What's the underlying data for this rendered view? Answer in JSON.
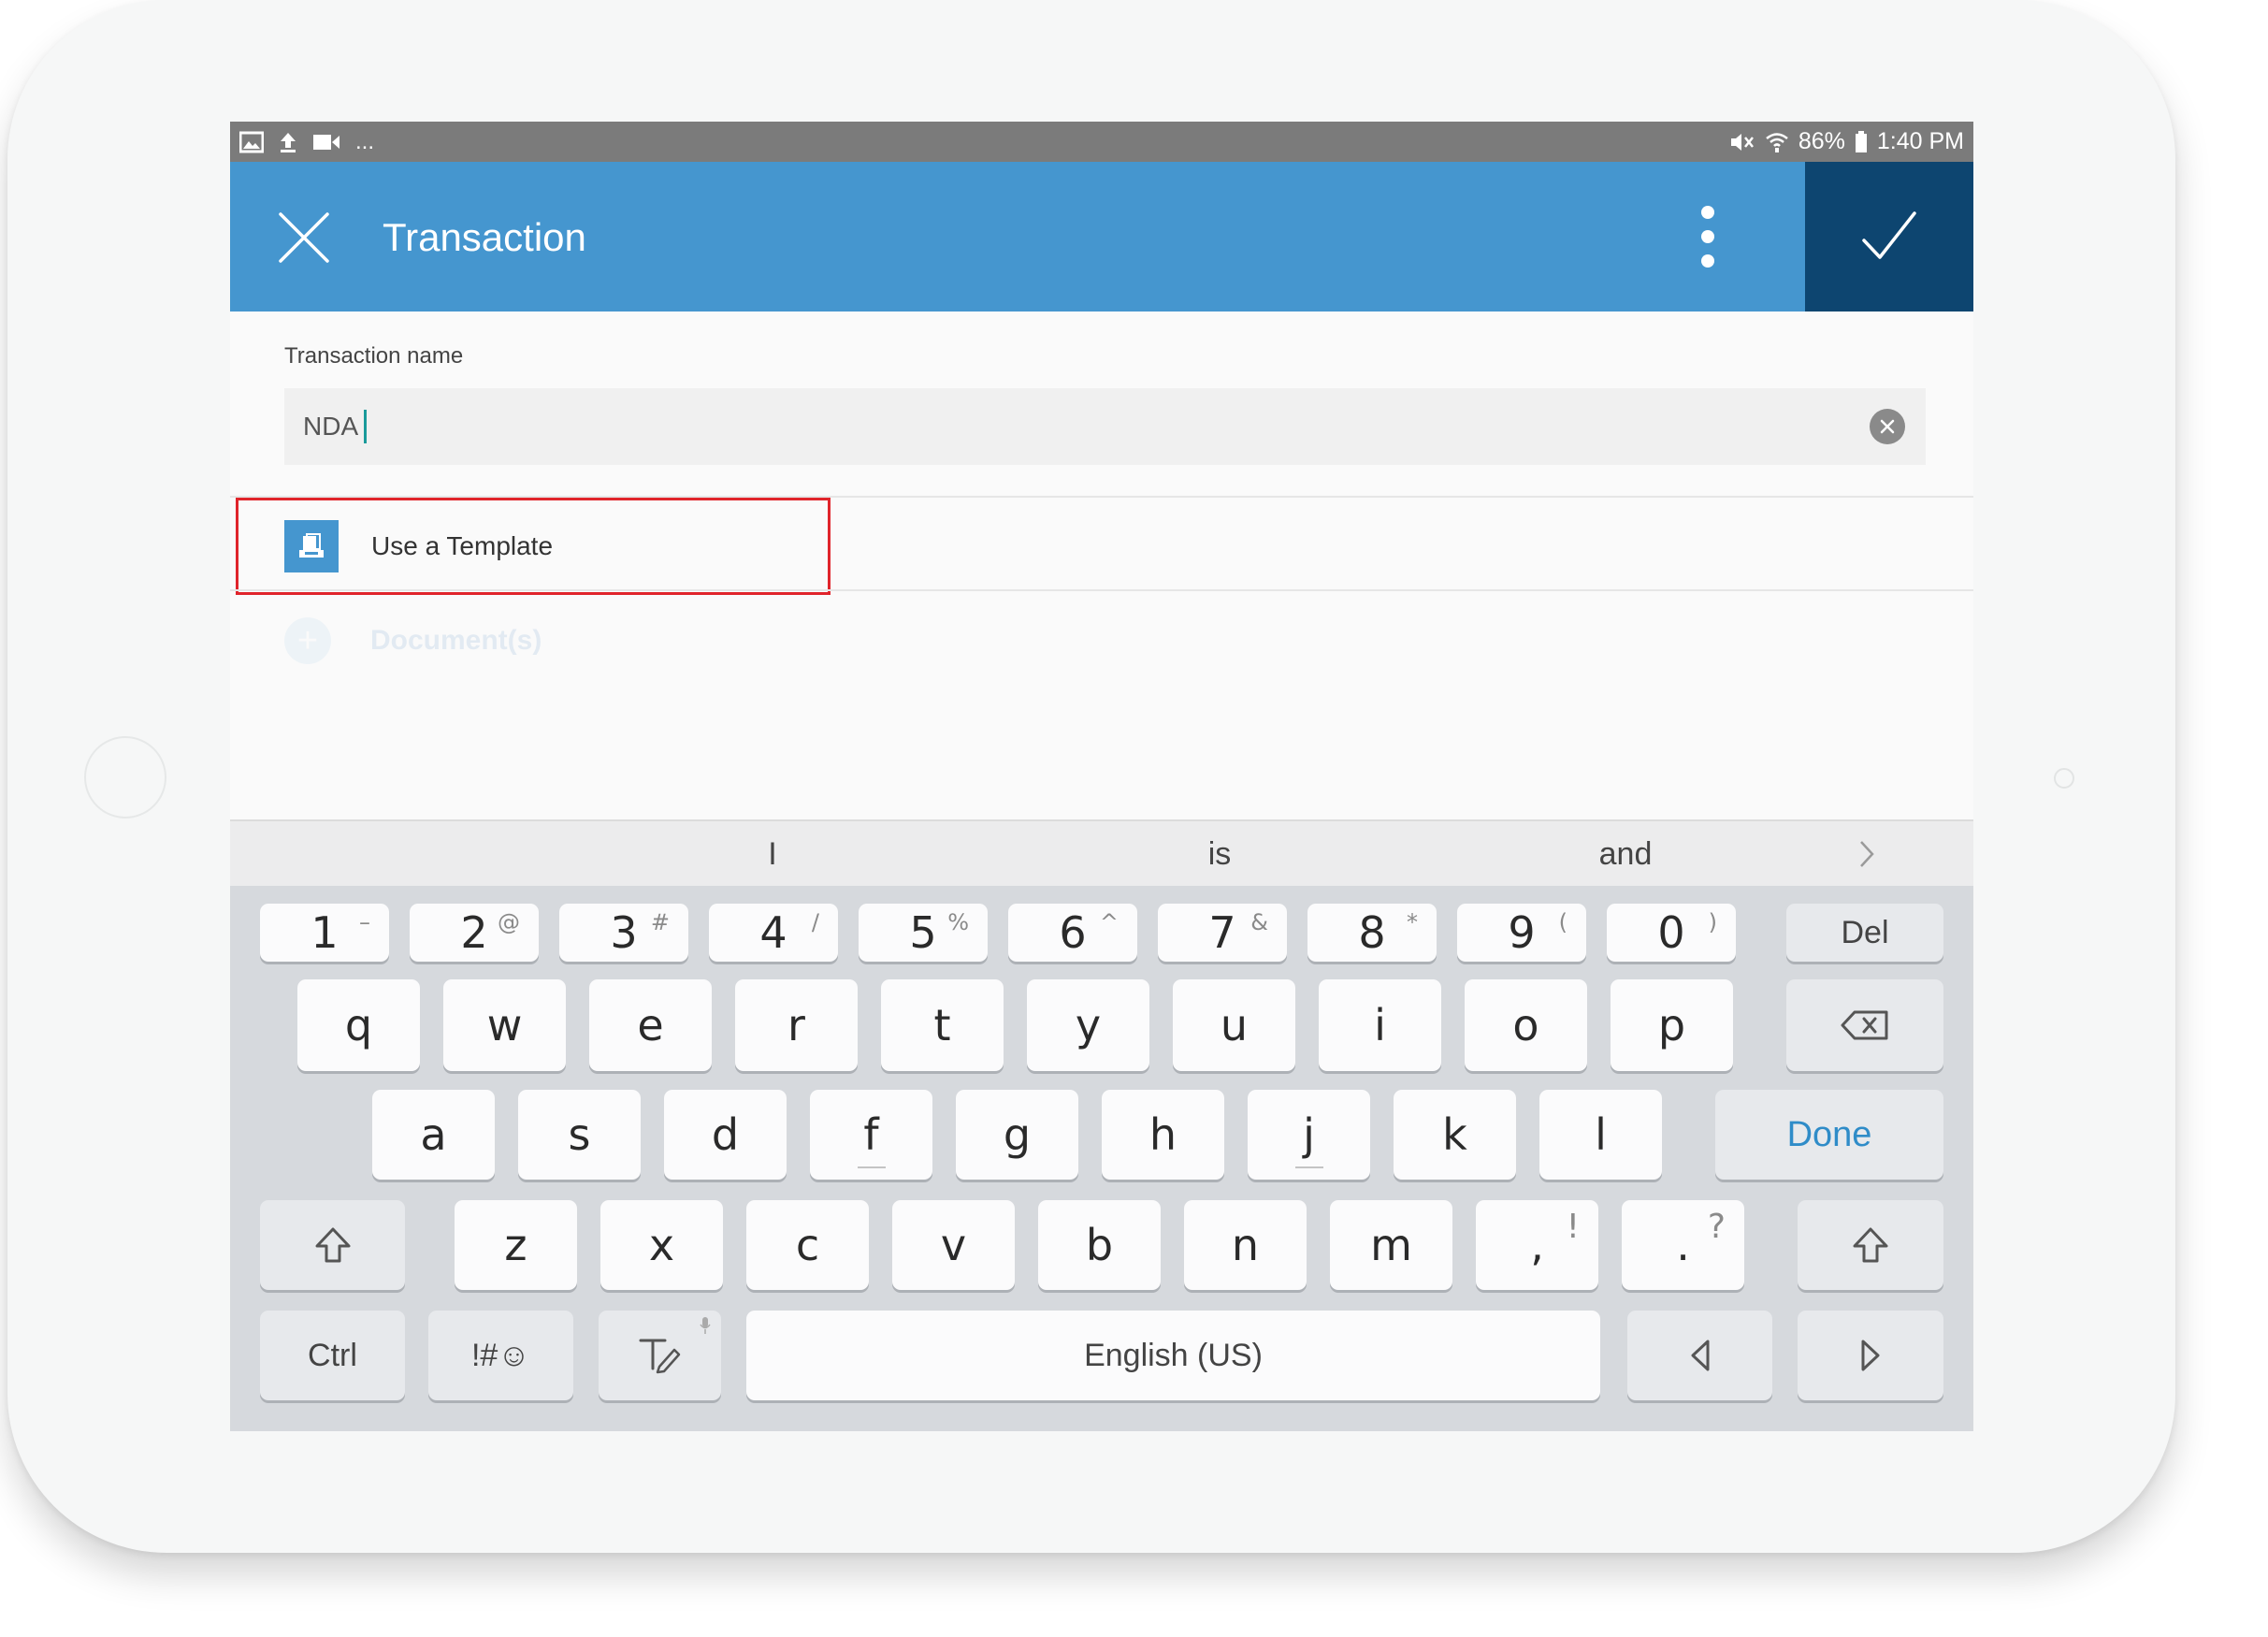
{
  "status_bar": {
    "left_icons": [
      "image-icon",
      "upload-icon",
      "video-icon"
    ],
    "overflow": "...",
    "right_icons": [
      "mute-icon",
      "wifi-icon",
      "battery-icon"
    ],
    "battery": "86%",
    "time": "1:40 PM"
  },
  "app_bar": {
    "title": "Transaction",
    "close_icon": "close-icon",
    "menu_icon": "more-vertical-icon",
    "confirm_icon": "check-icon",
    "background": "#4596cf",
    "confirm_background": "#0d4570"
  },
  "form": {
    "name_label": "Transaction name",
    "name_value": "NDA",
    "clear_icon": "clear-icon"
  },
  "template_option": {
    "label": "Use a Template",
    "icon": "template-icon",
    "highlight_color": "#e0242b"
  },
  "documents_option": {
    "label": "Document(s)",
    "icon": "add-icon",
    "glyph": "+"
  },
  "suggestions": [
    "I",
    "is",
    "and"
  ],
  "keyboard": {
    "number_row": [
      {
        "main": "1",
        "sub": "–"
      },
      {
        "main": "2",
        "sub": "@"
      },
      {
        "main": "3",
        "sub": "#"
      },
      {
        "main": "4",
        "sub": "/"
      },
      {
        "main": "5",
        "sub": "%"
      },
      {
        "main": "6",
        "sub": "^"
      },
      {
        "main": "7",
        "sub": "&"
      },
      {
        "main": "8",
        "sub": "*"
      },
      {
        "main": "9",
        "sub": "("
      },
      {
        "main": "0",
        "sub": ")"
      }
    ],
    "del_label": "Del",
    "row_q": [
      "q",
      "w",
      "e",
      "r",
      "t",
      "y",
      "u",
      "i",
      "o",
      "p"
    ],
    "row_a": [
      "a",
      "s",
      "d",
      "f",
      "g",
      "h",
      "j",
      "k",
      "l"
    ],
    "done_label": "Done",
    "row_z": [
      "z",
      "x",
      "c",
      "v",
      "b",
      "n",
      "m"
    ],
    "comma": {
      "main": ",",
      "sub": "!"
    },
    "period": {
      "main": ".",
      "sub": "?"
    },
    "ctrl_label": "Ctrl",
    "symbols_label": "!#☺",
    "space_label": "English (US)"
  }
}
